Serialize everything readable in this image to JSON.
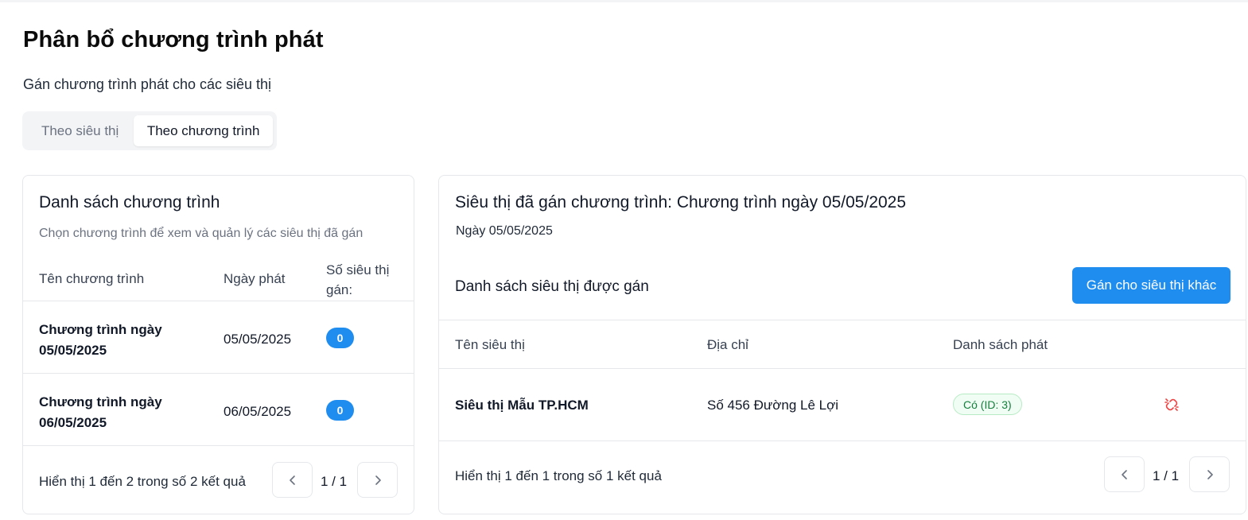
{
  "page": {
    "title": "Phân bổ chương trình phát",
    "subtitle": "Gán chương trình phát cho các siêu thị"
  },
  "tabs": [
    {
      "label": "Theo siêu thị",
      "active": false
    },
    {
      "label": "Theo chương trình",
      "active": true
    }
  ],
  "left_panel": {
    "title": "Danh sách chương trình",
    "description": "Chọn chương trình để xem và quản lý các siêu thị đã gán",
    "columns": {
      "name": "Tên chương trình",
      "date": "Ngày phát",
      "count_line1": "Số siêu thị",
      "count_line2": "gán:"
    },
    "rows": [
      {
        "name_line1": "Chương trình ngày",
        "name_line2": "05/05/2025",
        "date": "05/05/2025",
        "count": "0"
      },
      {
        "name_line1": "Chương trình ngày",
        "name_line2": "06/05/2025",
        "date": "06/05/2025",
        "count": "0"
      }
    ],
    "footer": {
      "summary": "Hiển thị 1 đến 2 trong số 2 kết quả",
      "page": "1 / 1"
    }
  },
  "right_panel": {
    "title": "Siêu thị đã gán chương trình: Chương trình ngày 05/05/2025",
    "date_line": "Ngày 05/05/2025",
    "section_title": "Danh sách siêu thị được gán",
    "assign_button": "Gán cho siêu thị khác",
    "columns": {
      "store": "Tên siêu thị",
      "address": "Địa chỉ",
      "playlist": "Danh sách phát"
    },
    "rows": [
      {
        "store": "Siêu thị Mẫu TP.HCM",
        "address": "Số 456 Đường Lê Lợi",
        "playlist": "Có (ID: 3)",
        "action_icon": "unlink-icon"
      }
    ],
    "footer": {
      "summary": "Hiển thị 1 đến 1 trong số 1 kết quả",
      "page": "1 / 1"
    }
  },
  "colors": {
    "accent": "#1f8cef",
    "success_text": "#15803d",
    "danger": "#ef4444"
  }
}
